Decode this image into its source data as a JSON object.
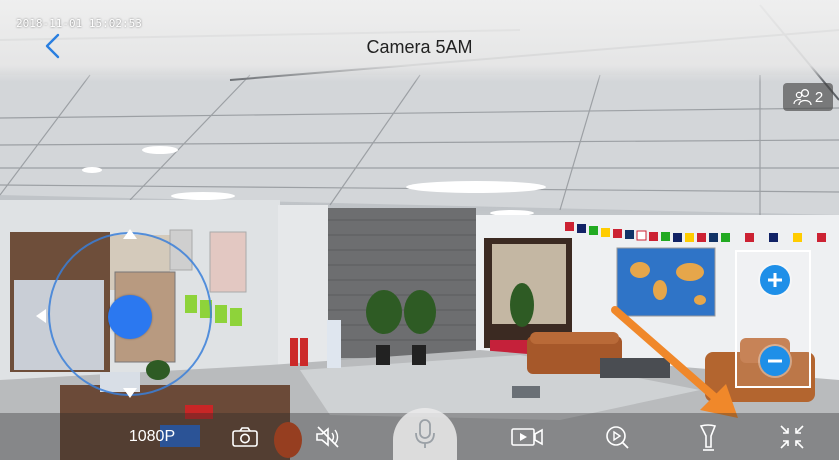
{
  "overlay": {
    "timestamp": "2018-11-01 15:02:53",
    "title": "Camera 5AM"
  },
  "viewers": {
    "icon": "viewers-icon",
    "count": "2"
  },
  "ptz": {
    "icon": "joystick-knob",
    "color": "#2b78f0"
  },
  "zoom": {
    "in_icon": "plus-icon",
    "out_icon": "minus-icon",
    "color": "#1e8fe8"
  },
  "toolbar": {
    "quality_label": "1080P",
    "items": [
      "camera-icon",
      "mute-icon",
      "microphone-icon",
      "record-video-icon",
      "playback-icon",
      "flashlight-icon",
      "exit-fullscreen-icon"
    ]
  },
  "annotation": {
    "color": "#f0882a"
  }
}
